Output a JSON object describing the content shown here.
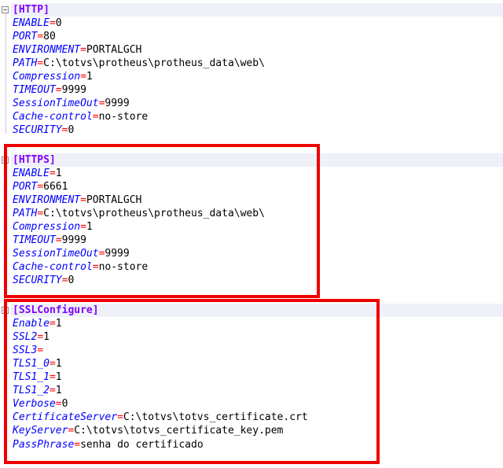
{
  "sections": [
    {
      "header": "[HTTP]",
      "highlighted": false,
      "entries": [
        {
          "key": "ENABLE",
          "value": "0"
        },
        {
          "key": "PORT",
          "value": "80"
        },
        {
          "key": "ENVIRONMENT",
          "value": "PORTALGCH"
        },
        {
          "key": "PATH",
          "value": "C:\\totvs\\protheus\\protheus_data\\web\\"
        },
        {
          "key": "Compression",
          "value": "1"
        },
        {
          "key": "TIMEOUT",
          "value": "9999"
        },
        {
          "key": "SessionTimeOut",
          "value": "9999"
        },
        {
          "key": "Cache-control",
          "value": "no-store"
        },
        {
          "key": "SECURITY",
          "value": "0"
        }
      ]
    },
    {
      "header": "[HTTPS]",
      "highlighted": true,
      "entries": [
        {
          "key": "ENABLE",
          "value": "1"
        },
        {
          "key": "PORT",
          "value": "6661"
        },
        {
          "key": "ENVIRONMENT",
          "value": "PORTALGCH"
        },
        {
          "key": "PATH",
          "value": "C:\\totvs\\protheus\\protheus_data\\web\\"
        },
        {
          "key": "Compression",
          "value": "1"
        },
        {
          "key": "TIMEOUT",
          "value": "9999"
        },
        {
          "key": "SessionTimeOut",
          "value": "9999"
        },
        {
          "key": "Cache-control",
          "value": "no-store"
        },
        {
          "key": "SECURITY",
          "value": "0"
        }
      ]
    },
    {
      "header": "[SSLConfigure]",
      "highlighted": true,
      "entries": [
        {
          "key": "Enable",
          "value": "1"
        },
        {
          "key": "SSL2",
          "value": "1"
        },
        {
          "key": "SSL3",
          "value": ""
        },
        {
          "key": "TLS1_0",
          "value": "1"
        },
        {
          "key": "TLS1_1",
          "value": "1"
        },
        {
          "key": "TLS1_2",
          "value": "1"
        },
        {
          "key": "Verbose",
          "value": "0"
        },
        {
          "key": "CertificateServer",
          "value": "C:\\totvs\\totvs_certificate.crt"
        },
        {
          "key": "KeyServer",
          "value": "C:\\totvs\\totvs_certificate_key.pem"
        },
        {
          "key": "PassPhrase",
          "value": "senha do certificado"
        }
      ]
    }
  ],
  "colors": {
    "section_header": "#8000ff",
    "key": "#0000ff",
    "equals": "#ff0000",
    "value": "#000000",
    "highlight_border": "#ee0000",
    "section_background": "#eef1f8"
  },
  "icons": {
    "fold_marker": "fold-collapse-icon"
  }
}
